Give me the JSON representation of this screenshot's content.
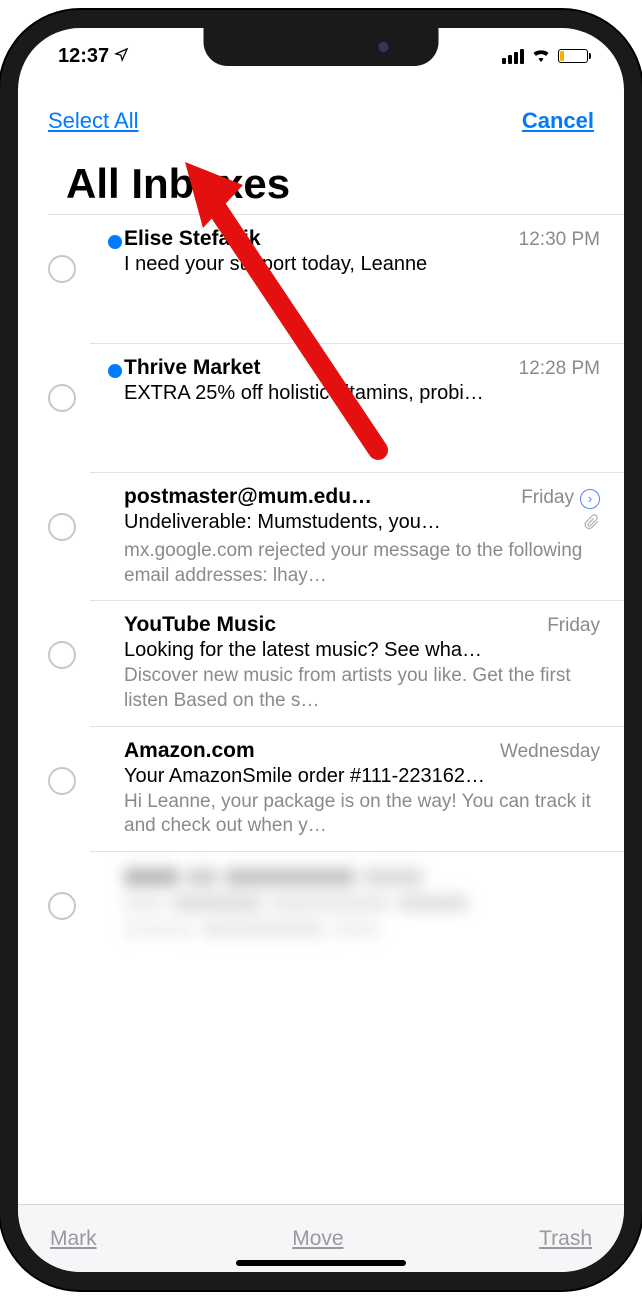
{
  "status": {
    "time": "12:37",
    "location_icon": "➤"
  },
  "nav": {
    "select_all": "Select All",
    "cancel": "Cancel"
  },
  "page_title": "All Inboxes",
  "emails": [
    {
      "sender": "Elise Stefanik",
      "time": "12:30 PM",
      "subject": "I need your support today, Leanne",
      "preview": "",
      "unread": true,
      "thread": false,
      "attachment": false
    },
    {
      "sender": "Thrive Market",
      "time": "12:28 PM",
      "subject": "EXTRA 25% off holistic vitamins, probi…",
      "preview": "",
      "unread": true,
      "thread": false,
      "attachment": false
    },
    {
      "sender": "postmaster@mum.edu…",
      "time": "Friday",
      "subject": "Undeliverable: Mumstudents, you…",
      "preview": "mx.google.com rejected your message to the following email addresses: lhay…",
      "unread": false,
      "thread": true,
      "attachment": true
    },
    {
      "sender": "YouTube Music",
      "time": "Friday",
      "subject": "Looking for the latest music? See wha…",
      "preview": "Discover new music from artists you like. Get the first listen Based on the s…",
      "unread": false,
      "thread": false,
      "attachment": false
    },
    {
      "sender": "Amazon.com",
      "time": "Wednesday",
      "subject": "Your AmazonSmile order #111-223162…",
      "preview": "Hi Leanne, your package is on the way! You can track it and check out when y…",
      "unread": false,
      "thread": false,
      "attachment": false
    }
  ],
  "toolbar": {
    "mark": "Mark",
    "move": "Move",
    "trash": "Trash"
  }
}
